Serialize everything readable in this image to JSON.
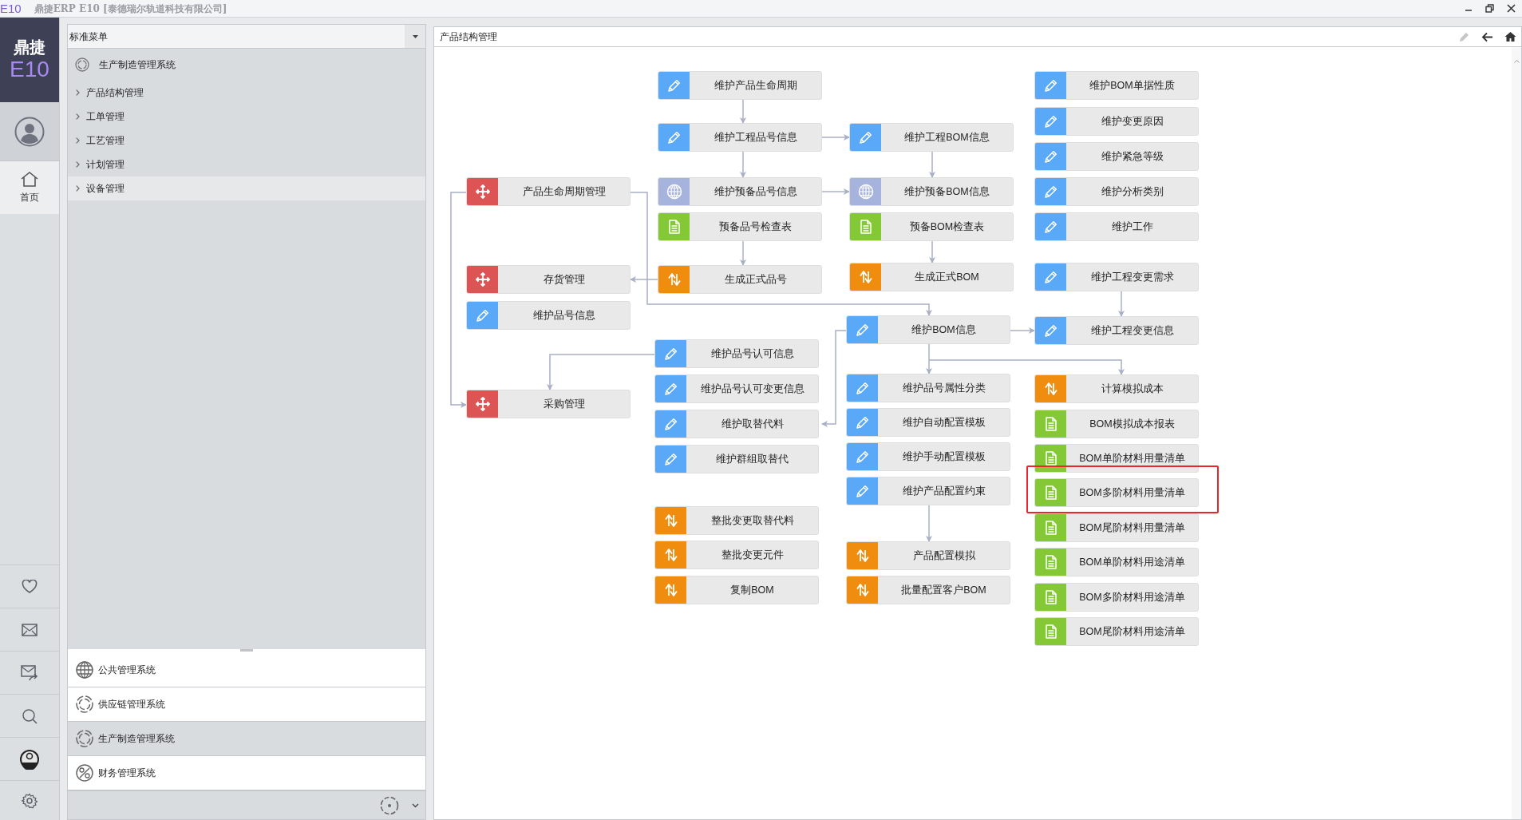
{
  "window": {
    "logo": "E10",
    "title": "鼎捷ERP E10 [泰德瑞尔轨道科技有限公司]"
  },
  "rail": {
    "brand": "鼎捷",
    "product": "E10",
    "home": "首页"
  },
  "menu": {
    "dropdown": "标准菜单",
    "system": "生产制造管理系统",
    "items": [
      {
        "label": "产品结构管理",
        "selected": false
      },
      {
        "label": "工单管理",
        "selected": false
      },
      {
        "label": "工艺管理",
        "selected": false
      },
      {
        "label": "计划管理",
        "selected": false
      },
      {
        "label": "设备管理",
        "selected": true
      }
    ]
  },
  "systems": [
    {
      "label": "公共管理系统",
      "kind": "globe",
      "selected": false
    },
    {
      "label": "供应链管理系统",
      "kind": "cycle",
      "selected": false
    },
    {
      "label": "生产制造管理系统",
      "kind": "cycle",
      "selected": true
    },
    {
      "label": "财务管理系统",
      "kind": "percent",
      "selected": false
    }
  ],
  "content": {
    "title": "产品结构管理",
    "nodes": [
      {
        "label": "维护产品生命周期",
        "kind": "edit",
        "highlighted": false
      },
      {
        "label": "维护工程品号信息",
        "kind": "edit",
        "highlighted": false
      },
      {
        "label": "维护预备品号信息",
        "kind": "globe",
        "highlighted": false
      },
      {
        "label": "预备品号检查表",
        "kind": "report",
        "highlighted": false
      },
      {
        "label": "生成正式品号",
        "kind": "convert",
        "highlighted": false
      },
      {
        "label": "维护工程BOM信息",
        "kind": "edit",
        "highlighted": false
      },
      {
        "label": "维护预备BOM信息",
        "kind": "globe",
        "highlighted": false
      },
      {
        "label": "预备BOM检查表",
        "kind": "report",
        "highlighted": false
      },
      {
        "label": "生成正式BOM",
        "kind": "convert",
        "highlighted": false
      },
      {
        "label": "维护BOM单据性质",
        "kind": "edit",
        "highlighted": false
      },
      {
        "label": "维护变更原因",
        "kind": "edit",
        "highlighted": false
      },
      {
        "label": "维护紧急等级",
        "kind": "edit",
        "highlighted": false
      },
      {
        "label": "维护分析类别",
        "kind": "edit",
        "highlighted": false
      },
      {
        "label": "维护工作",
        "kind": "edit",
        "highlighted": false
      },
      {
        "label": "维护工程变更需求",
        "kind": "edit",
        "highlighted": false
      },
      {
        "label": "产品生命周期管理",
        "kind": "module",
        "highlighted": false
      },
      {
        "label": "存货管理",
        "kind": "module",
        "highlighted": false
      },
      {
        "label": "维护品号信息",
        "kind": "edit",
        "highlighted": false
      },
      {
        "label": "维护BOM信息",
        "kind": "edit",
        "highlighted": false
      },
      {
        "label": "维护工程变更信息",
        "kind": "edit",
        "highlighted": false
      },
      {
        "label": "维护品号认可信息",
        "kind": "edit",
        "highlighted": false
      },
      {
        "label": "维护品号认可变更信息",
        "kind": "edit",
        "highlighted": false
      },
      {
        "label": "维护取替代料",
        "kind": "edit",
        "highlighted": false
      },
      {
        "label": "维护群组取替代",
        "kind": "edit",
        "highlighted": false
      },
      {
        "label": "整批变更取替代料",
        "kind": "convert",
        "highlighted": false
      },
      {
        "label": "整批变更元件",
        "kind": "convert",
        "highlighted": false
      },
      {
        "label": "复制BOM",
        "kind": "convert",
        "highlighted": false
      },
      {
        "label": "采购管理",
        "kind": "module",
        "highlighted": false
      },
      {
        "label": "维护品号属性分类",
        "kind": "edit",
        "highlighted": false
      },
      {
        "label": "维护自动配置模板",
        "kind": "edit",
        "highlighted": false
      },
      {
        "label": "维护手动配置模板",
        "kind": "edit",
        "highlighted": false
      },
      {
        "label": "维护产品配置约束",
        "kind": "edit",
        "highlighted": false
      },
      {
        "label": "产品配置模拟",
        "kind": "convert",
        "highlighted": false
      },
      {
        "label": "批量配置客户BOM",
        "kind": "convert",
        "highlighted": false
      },
      {
        "label": "计算模拟成本",
        "kind": "convert",
        "highlighted": false
      },
      {
        "label": "BOM模拟成本报表",
        "kind": "report",
        "highlighted": false
      },
      {
        "label": "BOM单阶材料用量清单",
        "kind": "report",
        "highlighted": false
      },
      {
        "label": "BOM多阶材料用量清单",
        "kind": "report",
        "highlighted": true
      },
      {
        "label": "BOM尾阶材料用量清单",
        "kind": "report",
        "highlighted": false
      },
      {
        "label": "BOM单阶材料用途清单",
        "kind": "report",
        "highlighted": false
      },
      {
        "label": "BOM多阶材料用途清单",
        "kind": "report",
        "highlighted": false
      },
      {
        "label": "BOM尾阶材料用途清单",
        "kind": "report",
        "highlighted": false
      }
    ]
  }
}
